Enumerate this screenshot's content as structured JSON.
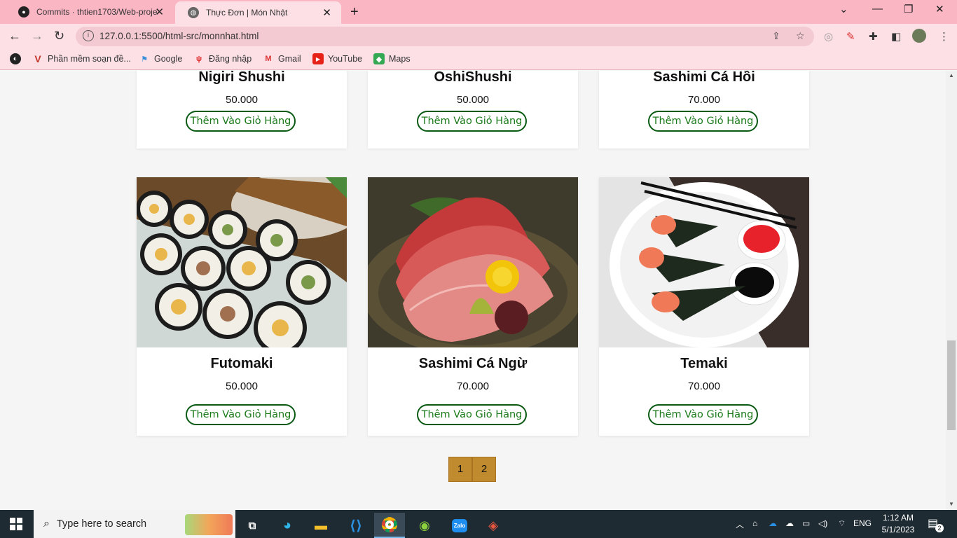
{
  "browser": {
    "tabs": [
      {
        "title": "Commits · thtien1703/Web-proje",
        "active": false
      },
      {
        "title": "Thực Đơn | Món Nhật",
        "active": true
      }
    ],
    "url": "127.0.0.1:5500/html-src/monnhat.html",
    "bookmarks": [
      "Phần mềm soạn đề...",
      "Google",
      "Đăng nhập",
      "Gmail",
      "YouTube",
      "Maps"
    ]
  },
  "menu": {
    "top_row": [
      {
        "name": "Nigiri Shushi",
        "price": "50.000",
        "button": "Thêm Vào Giỏ Hàng"
      },
      {
        "name": "OshiShushi",
        "price": "50.000",
        "button": "Thêm Vào Giỏ Hàng"
      },
      {
        "name": "Sashimi Cá Hồi",
        "price": "70.000",
        "button": "Thêm Vào Giỏ Hàng"
      }
    ],
    "bottom_row": [
      {
        "name": "Futomaki",
        "price": "50.000",
        "button": "Thêm Vào Giỏ Hàng"
      },
      {
        "name": "Sashimi Cá Ngừ",
        "price": "70.000",
        "button": "Thêm Vào Giỏ Hàng"
      },
      {
        "name": "Temaki",
        "price": "70.000",
        "button": "Thêm Vào Giỏ Hàng"
      }
    ]
  },
  "pagination": [
    "1",
    "2"
  ],
  "taskbar": {
    "search_placeholder": "Type here to search",
    "language": "ENG",
    "time": "1:12 AM",
    "date": "5/1/2023",
    "notifications": "2"
  },
  "colors": {
    "chrome_pink": "#fbb6c4",
    "button_green": "#1a7a1a",
    "pagination_gold": "#c08a2e"
  }
}
